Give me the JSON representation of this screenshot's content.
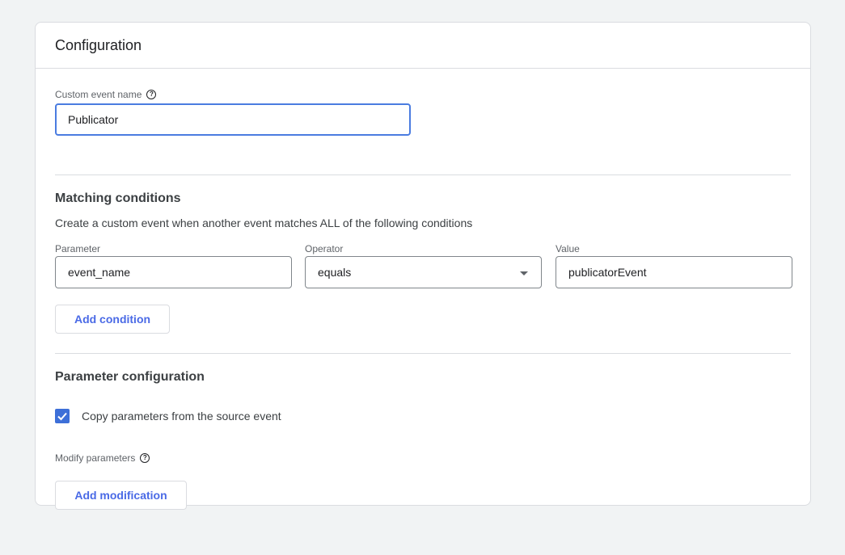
{
  "card": {
    "title": "Configuration"
  },
  "event_name": {
    "label": "Custom event name",
    "value": "Publicator"
  },
  "matching": {
    "title": "Matching conditions",
    "description": "Create a custom event when another event matches ALL of the following conditions",
    "parameter": {
      "label": "Parameter",
      "value": "event_name"
    },
    "operator": {
      "label": "Operator",
      "value": "equals"
    },
    "value": {
      "label": "Value",
      "value": "publicatorEvent"
    },
    "add_condition_label": "Add condition"
  },
  "param_config": {
    "title": "Parameter configuration",
    "copy_label": "Copy parameters from the source event",
    "copy_checked": true,
    "modify_label": "Modify parameters",
    "add_modification_label": "Add modification"
  },
  "colors": {
    "accent": "#4a6ae6",
    "checkbox": "#3d6fd8",
    "focus": "#4a7ce0",
    "background": "#f1f3f4"
  },
  "icons": {
    "help": "help-circle-icon",
    "dropdown": "chevron-down-icon",
    "check": "check-icon"
  }
}
